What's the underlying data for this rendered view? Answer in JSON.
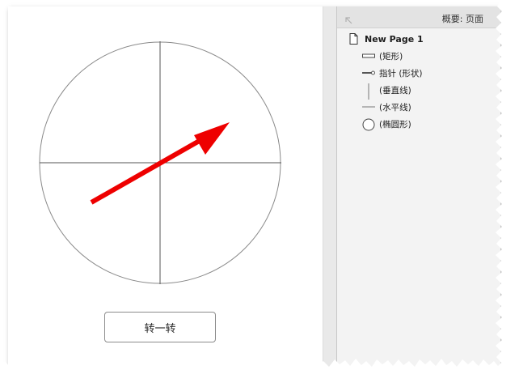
{
  "canvas": {
    "spin_button_label": "转一转"
  },
  "outline_panel": {
    "title": "概要: 页面",
    "page": {
      "label": "New Page 1",
      "icon": "page-icon"
    },
    "items": [
      {
        "label": "(矩形)",
        "icon": "rectangle-icon"
      },
      {
        "label": "指针 (形状)",
        "icon": "arrow-shape-icon"
      },
      {
        "label": "(垂直线)",
        "icon": "vertical-line-icon"
      },
      {
        "label": "(水平线)",
        "icon": "horizontal-line-icon"
      },
      {
        "label": "(椭圆形)",
        "icon": "ellipse-icon"
      }
    ]
  },
  "colors": {
    "pointer": "#ee0000",
    "circle_stroke": "#8a8a8a",
    "panel_bg": "#f3f3f3",
    "header_bg": "#e3e3e3"
  }
}
